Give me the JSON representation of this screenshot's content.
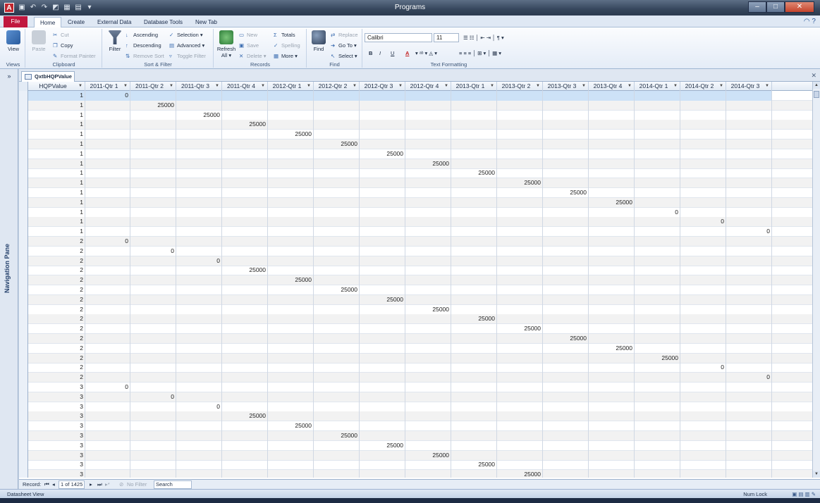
{
  "window": {
    "app_icon": "A",
    "title": "Programs",
    "minimize": "–",
    "maximize": "□",
    "close": "✕"
  },
  "ribbon_tabs": [
    "File",
    "Home",
    "Create",
    "External Data",
    "Database Tools",
    "New Tab"
  ],
  "ribbon": {
    "views": {
      "label": "Views",
      "view": "View"
    },
    "clipboard": {
      "label": "Clipboard",
      "paste": "Paste",
      "cut": "Cut",
      "copy": "Copy",
      "format_painter": "Format Painter"
    },
    "sort_filter": {
      "label": "Sort & Filter",
      "filter": "Filter",
      "ascending": "Ascending",
      "descending": "Descending",
      "remove_sort": "Remove Sort",
      "selection": "Selection ▾",
      "advanced": "Advanced ▾",
      "toggle_filter": "Toggle Filter"
    },
    "records": {
      "label": "Records",
      "refresh": "Refresh All ▾",
      "new": "New",
      "save": "Save",
      "delete": "Delete ▾",
      "totals": "Totals",
      "spelling": "Spelling",
      "more": "More ▾"
    },
    "find": {
      "label": "Find",
      "find": "Find",
      "replace": "Replace",
      "goto": "Go To ▾",
      "select": "Select ▾"
    },
    "text_formatting": {
      "label": "Text Formatting",
      "font": "Calibri",
      "size": "11",
      "bold": "B",
      "italic": "I",
      "underline": "U",
      "font_color": "A"
    }
  },
  "nav_pane": {
    "label": "Navigation Pane",
    "toggle": "»"
  },
  "document": {
    "tab": "QxtbHQPValue"
  },
  "columns": [
    "HQPValue",
    "2011-Qtr 1",
    "2011-Qtr 2",
    "2011-Qtr 3",
    "2011-Qtr 4",
    "2012-Qtr 1",
    "2012-Qtr 2",
    "2012-Qtr 3",
    "2012-Qtr 4",
    "2013-Qtr 1",
    "2013-Qtr 2",
    "2013-Qtr 3",
    "2013-Qtr 4",
    "2014-Qtr 1",
    "2014-Qtr 2",
    "2014-Qtr 3"
  ],
  "rows": [
    [
      "1",
      "0",
      "",
      "",
      "",
      "",
      "",
      "",
      "",
      "",
      "",
      "",
      "",
      "",
      "",
      ""
    ],
    [
      "1",
      "",
      "25000",
      "",
      "",
      "",
      "",
      "",
      "",
      "",
      "",
      "",
      "",
      "",
      "",
      ""
    ],
    [
      "1",
      "",
      "",
      "25000",
      "",
      "",
      "",
      "",
      "",
      "",
      "",
      "",
      "",
      "",
      "",
      ""
    ],
    [
      "1",
      "",
      "",
      "",
      "25000",
      "",
      "",
      "",
      "",
      "",
      "",
      "",
      "",
      "",
      "",
      ""
    ],
    [
      "1",
      "",
      "",
      "",
      "",
      "25000",
      "",
      "",
      "",
      "",
      "",
      "",
      "",
      "",
      "",
      ""
    ],
    [
      "1",
      "",
      "",
      "",
      "",
      "",
      "25000",
      "",
      "",
      "",
      "",
      "",
      "",
      "",
      "",
      ""
    ],
    [
      "1",
      "",
      "",
      "",
      "",
      "",
      "",
      "25000",
      "",
      "",
      "",
      "",
      "",
      "",
      "",
      ""
    ],
    [
      "1",
      "",
      "",
      "",
      "",
      "",
      "",
      "",
      "25000",
      "",
      "",
      "",
      "",
      "",
      "",
      ""
    ],
    [
      "1",
      "",
      "",
      "",
      "",
      "",
      "",
      "",
      "",
      "25000",
      "",
      "",
      "",
      "",
      "",
      ""
    ],
    [
      "1",
      "",
      "",
      "",
      "",
      "",
      "",
      "",
      "",
      "",
      "25000",
      "",
      "",
      "",
      "",
      ""
    ],
    [
      "1",
      "",
      "",
      "",
      "",
      "",
      "",
      "",
      "",
      "",
      "",
      "25000",
      "",
      "",
      "",
      ""
    ],
    [
      "1",
      "",
      "",
      "",
      "",
      "",
      "",
      "",
      "",
      "",
      "",
      "",
      "25000",
      "",
      "",
      ""
    ],
    [
      "1",
      "",
      "",
      "",
      "",
      "",
      "",
      "",
      "",
      "",
      "",
      "",
      "",
      "0",
      "",
      ""
    ],
    [
      "1",
      "",
      "",
      "",
      "",
      "",
      "",
      "",
      "",
      "",
      "",
      "",
      "",
      "",
      "0",
      ""
    ],
    [
      "1",
      "",
      "",
      "",
      "",
      "",
      "",
      "",
      "",
      "",
      "",
      "",
      "",
      "",
      "",
      "0"
    ],
    [
      "2",
      "0",
      "",
      "",
      "",
      "",
      "",
      "",
      "",
      "",
      "",
      "",
      "",
      "",
      "",
      ""
    ],
    [
      "2",
      "",
      "0",
      "",
      "",
      "",
      "",
      "",
      "",
      "",
      "",
      "",
      "",
      "",
      "",
      ""
    ],
    [
      "2",
      "",
      "",
      "0",
      "",
      "",
      "",
      "",
      "",
      "",
      "",
      "",
      "",
      "",
      "",
      ""
    ],
    [
      "2",
      "",
      "",
      "",
      "25000",
      "",
      "",
      "",
      "",
      "",
      "",
      "",
      "",
      "",
      "",
      ""
    ],
    [
      "2",
      "",
      "",
      "",
      "",
      "25000",
      "",
      "",
      "",
      "",
      "",
      "",
      "",
      "",
      "",
      ""
    ],
    [
      "2",
      "",
      "",
      "",
      "",
      "",
      "25000",
      "",
      "",
      "",
      "",
      "",
      "",
      "",
      "",
      ""
    ],
    [
      "2",
      "",
      "",
      "",
      "",
      "",
      "",
      "25000",
      "",
      "",
      "",
      "",
      "",
      "",
      "",
      ""
    ],
    [
      "2",
      "",
      "",
      "",
      "",
      "",
      "",
      "",
      "25000",
      "",
      "",
      "",
      "",
      "",
      "",
      ""
    ],
    [
      "2",
      "",
      "",
      "",
      "",
      "",
      "",
      "",
      "",
      "25000",
      "",
      "",
      "",
      "",
      "",
      ""
    ],
    [
      "2",
      "",
      "",
      "",
      "",
      "",
      "",
      "",
      "",
      "",
      "25000",
      "",
      "",
      "",
      "",
      ""
    ],
    [
      "2",
      "",
      "",
      "",
      "",
      "",
      "",
      "",
      "",
      "",
      "",
      "25000",
      "",
      "",
      "",
      ""
    ],
    [
      "2",
      "",
      "",
      "",
      "",
      "",
      "",
      "",
      "",
      "",
      "",
      "",
      "25000",
      "",
      "",
      ""
    ],
    [
      "2",
      "",
      "",
      "",
      "",
      "",
      "",
      "",
      "",
      "",
      "",
      "",
      "",
      "25000",
      "",
      ""
    ],
    [
      "2",
      "",
      "",
      "",
      "",
      "",
      "",
      "",
      "",
      "",
      "",
      "",
      "",
      "",
      "0",
      ""
    ],
    [
      "2",
      "",
      "",
      "",
      "",
      "",
      "",
      "",
      "",
      "",
      "",
      "",
      "",
      "",
      "",
      "0"
    ],
    [
      "3",
      "0",
      "",
      "",
      "",
      "",
      "",
      "",
      "",
      "",
      "",
      "",
      "",
      "",
      "",
      ""
    ],
    [
      "3",
      "",
      "0",
      "",
      "",
      "",
      "",
      "",
      "",
      "",
      "",
      "",
      "",
      "",
      "",
      ""
    ],
    [
      "3",
      "",
      "",
      "0",
      "",
      "",
      "",
      "",
      "",
      "",
      "",
      "",
      "",
      "",
      "",
      ""
    ],
    [
      "3",
      "",
      "",
      "",
      "25000",
      "",
      "",
      "",
      "",
      "",
      "",
      "",
      "",
      "",
      "",
      ""
    ],
    [
      "3",
      "",
      "",
      "",
      "",
      "25000",
      "",
      "",
      "",
      "",
      "",
      "",
      "",
      "",
      "",
      ""
    ],
    [
      "3",
      "",
      "",
      "",
      "",
      "",
      "25000",
      "",
      "",
      "",
      "",
      "",
      "",
      "",
      "",
      ""
    ],
    [
      "3",
      "",
      "",
      "",
      "",
      "",
      "",
      "25000",
      "",
      "",
      "",
      "",
      "",
      "",
      "",
      ""
    ],
    [
      "3",
      "",
      "",
      "",
      "",
      "",
      "",
      "",
      "25000",
      "",
      "",
      "",
      "",
      "",
      "",
      ""
    ],
    [
      "3",
      "",
      "",
      "",
      "",
      "",
      "",
      "",
      "",
      "25000",
      "",
      "",
      "",
      "",
      "",
      ""
    ],
    [
      "3",
      "",
      "",
      "",
      "",
      "",
      "",
      "",
      "",
      "",
      "25000",
      "",
      "",
      "",
      "",
      ""
    ]
  ],
  "record_nav": {
    "label": "Record:",
    "first": "⏮",
    "prev": "◂",
    "position": "1 of 1425",
    "next": "▸",
    "last": "⏭",
    "new": "▸*",
    "filter": "No Filter",
    "search": "Search"
  },
  "status": {
    "left": "Datasheet View",
    "num_lock": "Num Lock"
  }
}
